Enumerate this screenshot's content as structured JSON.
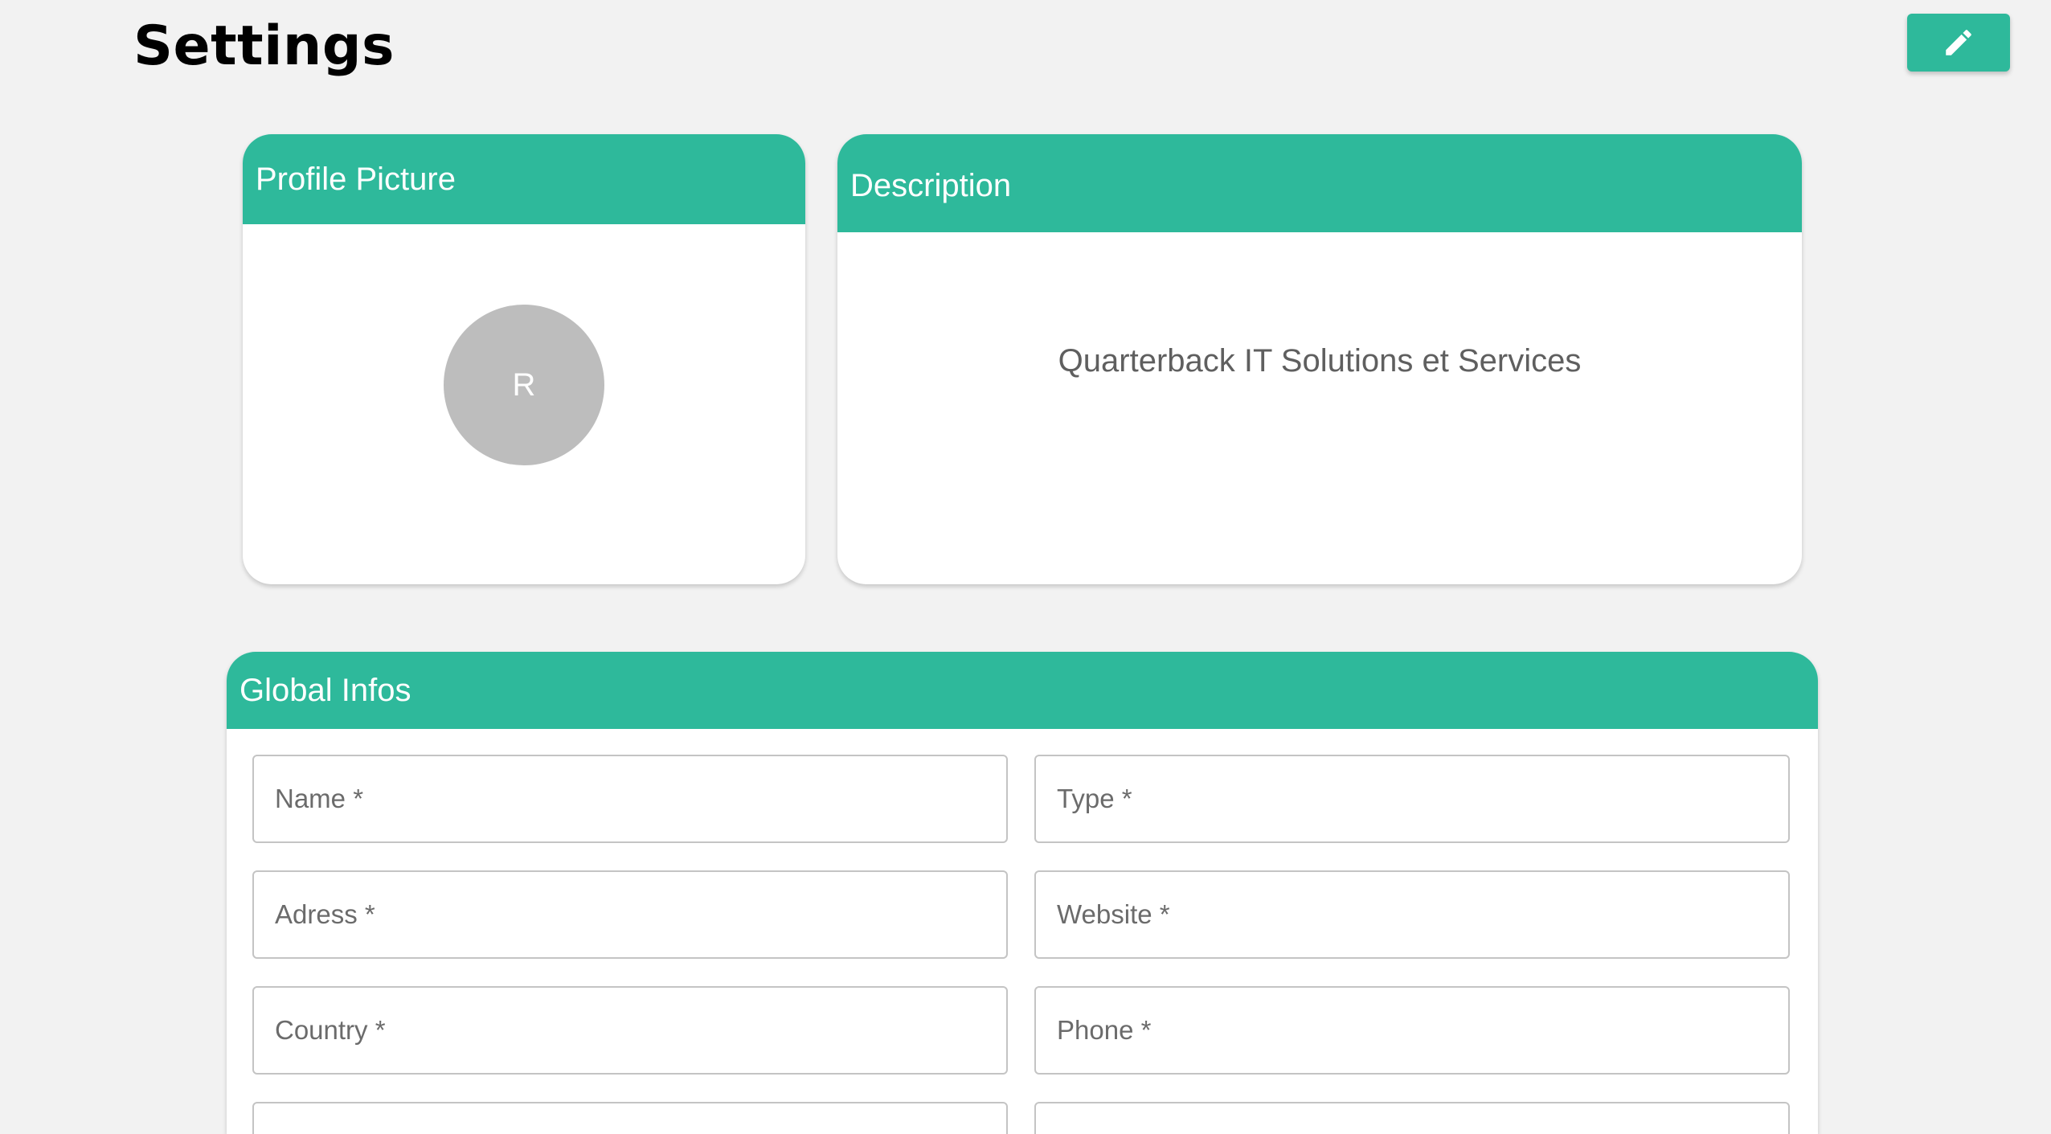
{
  "header": {
    "title": "Settings",
    "edit_icon": "pencil-icon"
  },
  "colors": {
    "accent": "#2eb99b",
    "background": "#f2f2f2",
    "avatar": "#bdbdbd"
  },
  "profile_card": {
    "title": "Profile Picture",
    "avatar_initial": "R"
  },
  "description_card": {
    "title": "Description",
    "text": "Quarterback IT Solutions et Services"
  },
  "global_card": {
    "title": "Global Infos",
    "fields": {
      "name": {
        "placeholder": "Name *",
        "value": ""
      },
      "type": {
        "placeholder": "Type *",
        "value": ""
      },
      "adress": {
        "placeholder": "Adress *",
        "value": ""
      },
      "website": {
        "placeholder": "Website *",
        "value": ""
      },
      "country": {
        "placeholder": "Country *",
        "value": ""
      },
      "phone": {
        "placeholder": "Phone *",
        "value": ""
      }
    }
  }
}
